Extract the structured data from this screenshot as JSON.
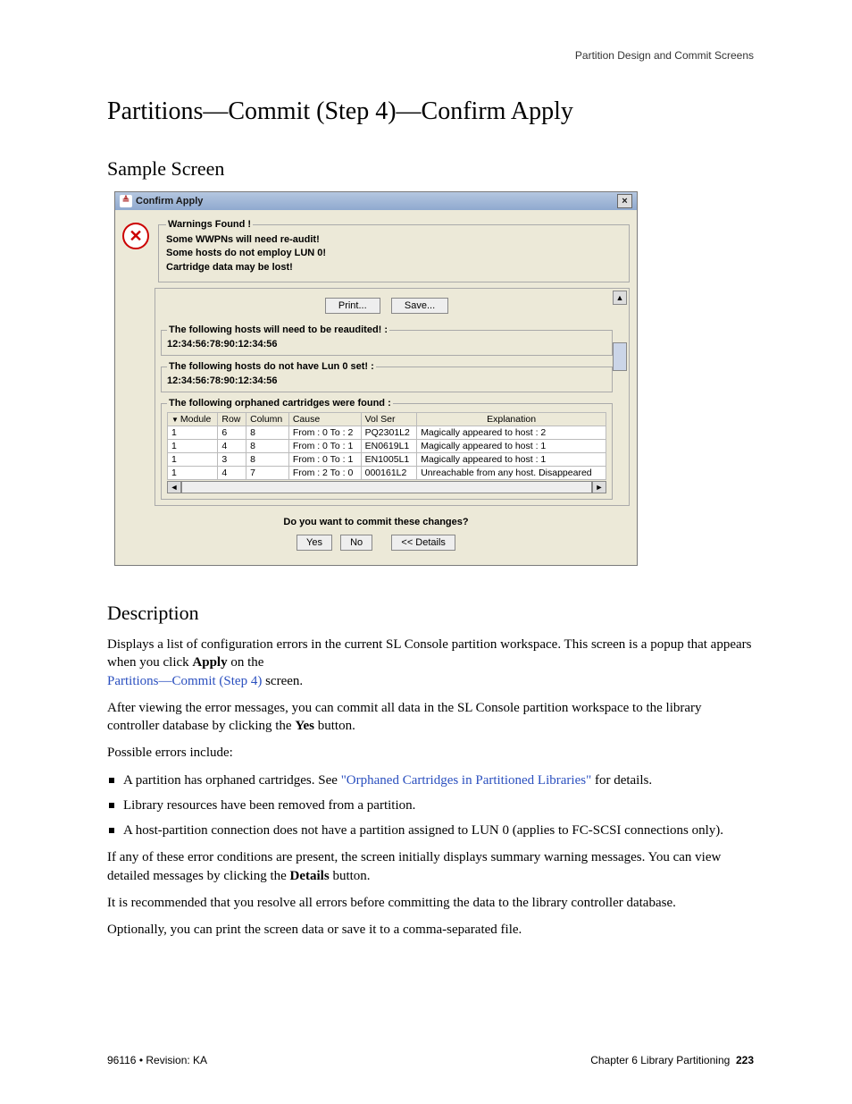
{
  "header": {
    "section": "Partition Design and Commit Screens"
  },
  "titles": {
    "h1": "Partitions—Commit (Step 4)—Confirm Apply",
    "sample": "Sample Screen",
    "description": "Description"
  },
  "dialog": {
    "title": "Confirm Apply",
    "warnings_legend": "Warnings Found !",
    "warnings": [
      "Some WWPNs will need re-audit!",
      "Some hosts do not employ LUN 0!",
      "Cartridge data may be lost!"
    ],
    "print_btn": "Print...",
    "save_btn": "Save...",
    "reaudit_legend": "The following hosts will need to be reaudited! :",
    "reaudit_host": "12:34:56:78:90:12:34:56",
    "lun0_legend": "The following hosts do not have Lun 0 set! :",
    "lun0_host": "12:34:56:78:90:12:34:56",
    "orphan_legend": "The following orphaned cartridges were found :",
    "columns": [
      "Module",
      "Row",
      "Column",
      "Cause",
      "Vol Ser",
      "Explanation"
    ],
    "rows": [
      {
        "module": "1",
        "row": "6",
        "column": "8",
        "cause": "From : 0 To : 2",
        "volser": "PQ2301L2",
        "explanation": "Magically appeared to host : 2"
      },
      {
        "module": "1",
        "row": "4",
        "column": "8",
        "cause": "From : 0 To : 1",
        "volser": "EN0619L1",
        "explanation": "Magically appeared to host : 1"
      },
      {
        "module": "1",
        "row": "3",
        "column": "8",
        "cause": "From : 0 To : 1",
        "volser": "EN1005L1",
        "explanation": "Magically appeared to host : 1"
      },
      {
        "module": "1",
        "row": "4",
        "column": "7",
        "cause": "From : 2 To : 0",
        "volser": "000161L2",
        "explanation": "Unreachable from any host. Disappeared"
      }
    ],
    "commit_q": "Do you want to commit these changes?",
    "yes": "Yes",
    "no": "No",
    "details": "<< Details"
  },
  "desc": {
    "p1a": "Displays a list of configuration errors in the current SL Console partition workspace. This screen is a popup that appears when you click ",
    "p1b": "Apply",
    "p1c": " on the ",
    "p1_link": "Partitions—Commit (Step 4)",
    "p1d": " screen.",
    "p2a": "After viewing the error messages, you can commit all data in the SL Console partition workspace to the library controller database by clicking the ",
    "p2b": "Yes",
    "p2c": " button.",
    "p3": "Possible errors include:",
    "li1a": "A partition has orphaned cartridges. See ",
    "li1_link": "\"Orphaned Cartridges in Partitioned Libraries\"",
    "li1b": " for details.",
    "li2": "Library resources have been removed from a partition.",
    "li3": "A host-partition connection does not have a partition assigned to LUN 0 (applies to FC-SCSI connections only).",
    "p4a": "If any of these error conditions are present, the screen initially displays summary warning messages. You can view detailed messages by clicking the ",
    "p4b": "Details",
    "p4c": " button.",
    "p5": "It is recommended that you resolve all errors before committing the data to the library controller database.",
    "p6": "Optionally, you can print the screen data or save it to a comma-separated file."
  },
  "footer": {
    "left": "96116 • Revision: KA",
    "right_a": "Chapter 6 Library Partitioning",
    "right_b": "223"
  }
}
